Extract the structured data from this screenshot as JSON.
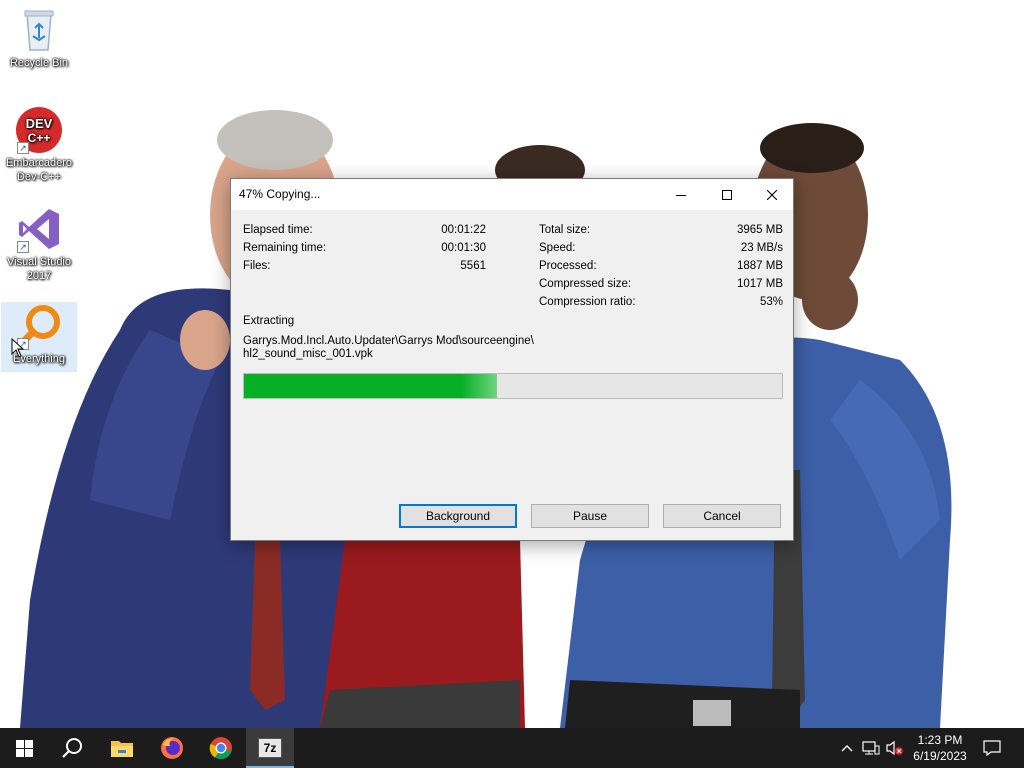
{
  "desktop": {
    "icons": [
      {
        "label": "Recycle Bin",
        "icon": "recycle-bin-icon"
      },
      {
        "label": "Embarcadero Dev-C++",
        "icon": "devcpp-icon",
        "badge": "DEV C++"
      },
      {
        "label": "Visual Studio 2017",
        "icon": "visual-studio-icon"
      },
      {
        "label": "Everything",
        "icon": "everything-search-icon"
      }
    ]
  },
  "dialog": {
    "title": "47% Copying...",
    "stats_left": [
      {
        "label": "Elapsed time:",
        "value": "00:01:22"
      },
      {
        "label": "Remaining time:",
        "value": "00:01:30"
      },
      {
        "label": "Files:",
        "value": "5561"
      }
    ],
    "stats_right": [
      {
        "label": "Total size:",
        "value": "3965 MB"
      },
      {
        "label": "Speed:",
        "value": "23 MB/s"
      },
      {
        "label": "Processed:",
        "value": "1887 MB"
      },
      {
        "label": "Compressed size:",
        "value": "1017 MB"
      },
      {
        "label": "Compression ratio:",
        "value": "53%"
      }
    ],
    "operation": "Extracting",
    "path_line1": "Garrys.Mod.Incl.Auto.Updater\\Garrys Mod\\sourceengine\\",
    "path_line2": "hl2_sound_misc_001.vpk",
    "progress_percent": 47,
    "progress_color": "#06b025",
    "buttons": {
      "background": "Background",
      "pause": "Pause",
      "cancel": "Cancel"
    }
  },
  "taskbar": {
    "items": [
      "windows-start-icon",
      "search-icon",
      "file-explorer-icon",
      "firefox-icon",
      "chrome-icon",
      "7zip-icon"
    ],
    "active_item": "7zip-icon",
    "app_7zip_label": "7z",
    "tray": [
      "chevron-up-icon",
      "network-icon",
      "volume-muted-icon"
    ],
    "clock_time": "1:23 PM",
    "clock_date": "6/19/2023",
    "notification_icon": "action-center-icon"
  }
}
